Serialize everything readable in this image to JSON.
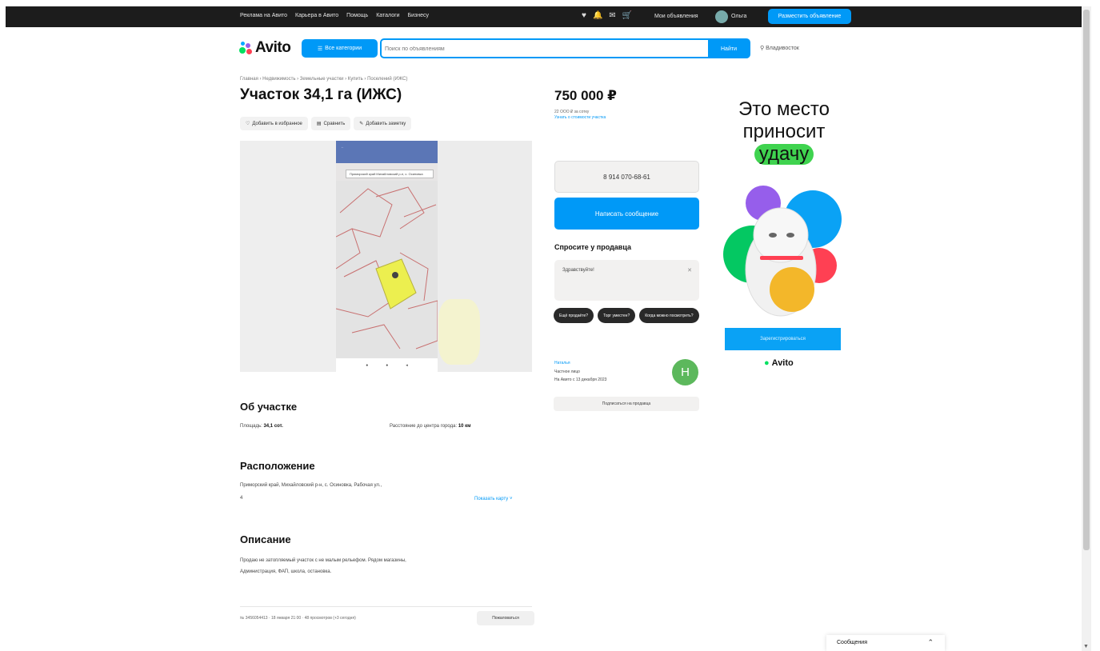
{
  "topbar": {
    "links": [
      "Реклама на Авито",
      "Карьера в Авито",
      "Помощь",
      "Каталоги",
      "Бизнесу"
    ],
    "my_ads": "Мои объявления",
    "user": "Ольга",
    "post_button": "Разместить объявление"
  },
  "header": {
    "logo": "Avito",
    "categories_button": "Все категории",
    "search_placeholder": "Поиск по объявлениям",
    "search_button": "Найти",
    "location": "Владивосток"
  },
  "listing": {
    "breadcrumbs": "Главная › Недвижимость › Земельные участки › Купить › Поселений (ИЖС)",
    "title": "Участок 34,1 га (ИЖС)",
    "actions": [
      "Добавить в избранное",
      "Сравнить",
      "Добавить заметку"
    ],
    "map_search_text": "Приморский край Михайловский р-н, с. Осиновка",
    "about_title": "Об участке",
    "area_label": "Площадь:",
    "area_value": "34,1 сот.",
    "distance_label": "Расстояние до центра города:",
    "distance_value": "10 км",
    "location_title": "Расположение",
    "address_line1": "Приморский край, Михайловский р-н, с. Осиновка, Рабочая ул.,",
    "address_line2": "4",
    "show_map": "Показать карту ˅",
    "description_title": "Описание",
    "description_line1": "Продаю не затопляемый участок с не малым рельефом. Рядом магазины,",
    "description_line2": "Администрация, ФАП, школа, остановка.",
    "meta": "№ 3456054413 · 18 января 21:00 · 48 просмотров (+3 сегодня)",
    "report": "Пожаловаться"
  },
  "sidebar": {
    "price": "750 000 ₽",
    "price_per": "22 OOO ₽ за сотку",
    "price_link": "Узнать о стоимости участка",
    "phone": "8 914 070-68-61",
    "message_button": "Написать сообщение",
    "ask_title": "Спросите у продавца",
    "ask_text": "Здравствуйте!",
    "chips": [
      "Ещё продаёте?",
      "Торг уместен?",
      "Когда можно посмотреть?"
    ],
    "seller_name": "Наталья",
    "seller_type": "Частное лицо",
    "seller_since": "На Авито с 13 декабря 2023",
    "seller_initial": "Н",
    "subscribe": "Подписаться на продавца"
  },
  "ad": {
    "line1": "Это место",
    "line2": "приносит",
    "highlight": "удачу",
    "button": "Зарегистрироваться",
    "logo": "Avito",
    "accent": "#3fd34f"
  },
  "messenger": {
    "label": "Сообщения"
  },
  "colors": {
    "brand_blue": "#0099f7",
    "topbar": "#1c1c1c",
    "seller_avatar": "#5cb85c"
  }
}
